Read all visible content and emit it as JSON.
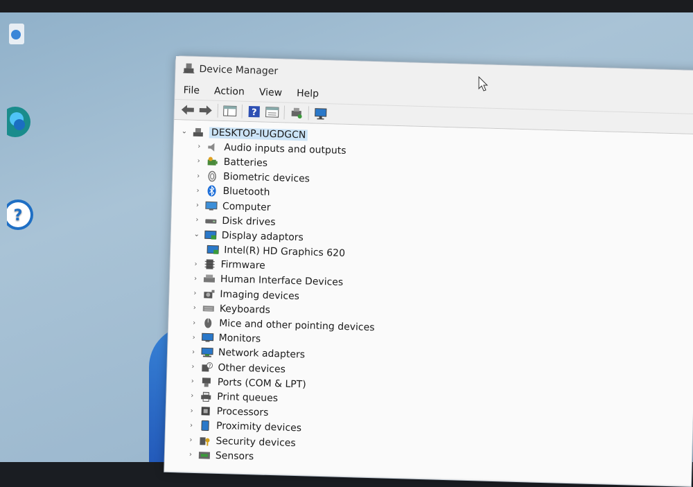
{
  "window": {
    "title": "Device Manager",
    "menu": [
      "File",
      "Action",
      "View",
      "Help"
    ]
  },
  "tree": {
    "root": "DESKTOP-IUGDGCN",
    "items": [
      {
        "label": "Audio inputs and outputs",
        "expanded": false,
        "icon": "speaker-icon"
      },
      {
        "label": "Batteries",
        "expanded": false,
        "icon": "battery-icon"
      },
      {
        "label": "Biometric devices",
        "expanded": false,
        "icon": "fingerprint-icon"
      },
      {
        "label": "Bluetooth",
        "expanded": false,
        "icon": "bluetooth-icon"
      },
      {
        "label": "Computer",
        "expanded": false,
        "icon": "computer-icon"
      },
      {
        "label": "Disk drives",
        "expanded": false,
        "icon": "disk-icon"
      },
      {
        "label": "Display adaptors",
        "expanded": true,
        "icon": "display-adapter-icon"
      },
      {
        "label": "Intel(R) HD Graphics 620",
        "child": true,
        "icon": "display-adapter-icon"
      },
      {
        "label": "Firmware",
        "expanded": false,
        "icon": "firmware-icon"
      },
      {
        "label": "Human Interface Devices",
        "expanded": false,
        "icon": "hid-icon"
      },
      {
        "label": "Imaging devices",
        "expanded": false,
        "icon": "camera-icon"
      },
      {
        "label": "Keyboards",
        "expanded": false,
        "icon": "keyboard-icon"
      },
      {
        "label": "Mice and other pointing devices",
        "expanded": false,
        "icon": "mouse-icon"
      },
      {
        "label": "Monitors",
        "expanded": false,
        "icon": "monitor-icon"
      },
      {
        "label": "Network adapters",
        "expanded": false,
        "icon": "network-icon"
      },
      {
        "label": "Other devices",
        "expanded": false,
        "icon": "unknown-device-icon"
      },
      {
        "label": "Ports (COM & LPT)",
        "expanded": false,
        "icon": "port-icon"
      },
      {
        "label": "Print queues",
        "expanded": false,
        "icon": "printer-icon"
      },
      {
        "label": "Processors",
        "expanded": false,
        "icon": "processor-icon"
      },
      {
        "label": "Proximity devices",
        "expanded": false,
        "icon": "proximity-icon"
      },
      {
        "label": "Security devices",
        "expanded": false,
        "icon": "security-icon"
      },
      {
        "label": "Sensors",
        "expanded": false,
        "icon": "sensor-icon"
      }
    ]
  }
}
